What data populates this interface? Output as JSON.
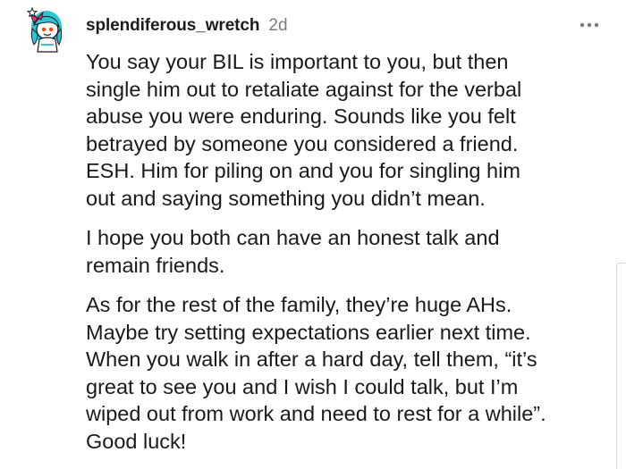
{
  "comment": {
    "author": "splendiferous_wretch",
    "age": "2d",
    "avatar_icon": "snoo-avatar-icon",
    "more_icon": "more-options-icon",
    "paragraphs": [
      "You say your BIL is important to you, but then\nsingle him out to retaliate against for the verbal\nabuse you were enduring. Sounds like you felt\nbetrayed by someone you considered a friend.\nESH. Him for piling on and you for singling him\nout and saying something you didn’t mean.",
      "I hope you both can have an honest talk and\nremain friends.",
      "As for the rest of the family, they’re huge AHs.\nMaybe try setting expectations earlier next time.\nWhen you walk in after a hard day, tell them, “it’s\ngreat to see you and I wish I could talk, but I’m\nwiped out from work and need to rest for a while”.\nGood luck!"
    ]
  },
  "colors": {
    "text": "#1a1a1b",
    "meta": "#7c7c7c",
    "avatar_hair": "#2ec4d6",
    "avatar_bow": "#ff2f6e"
  }
}
